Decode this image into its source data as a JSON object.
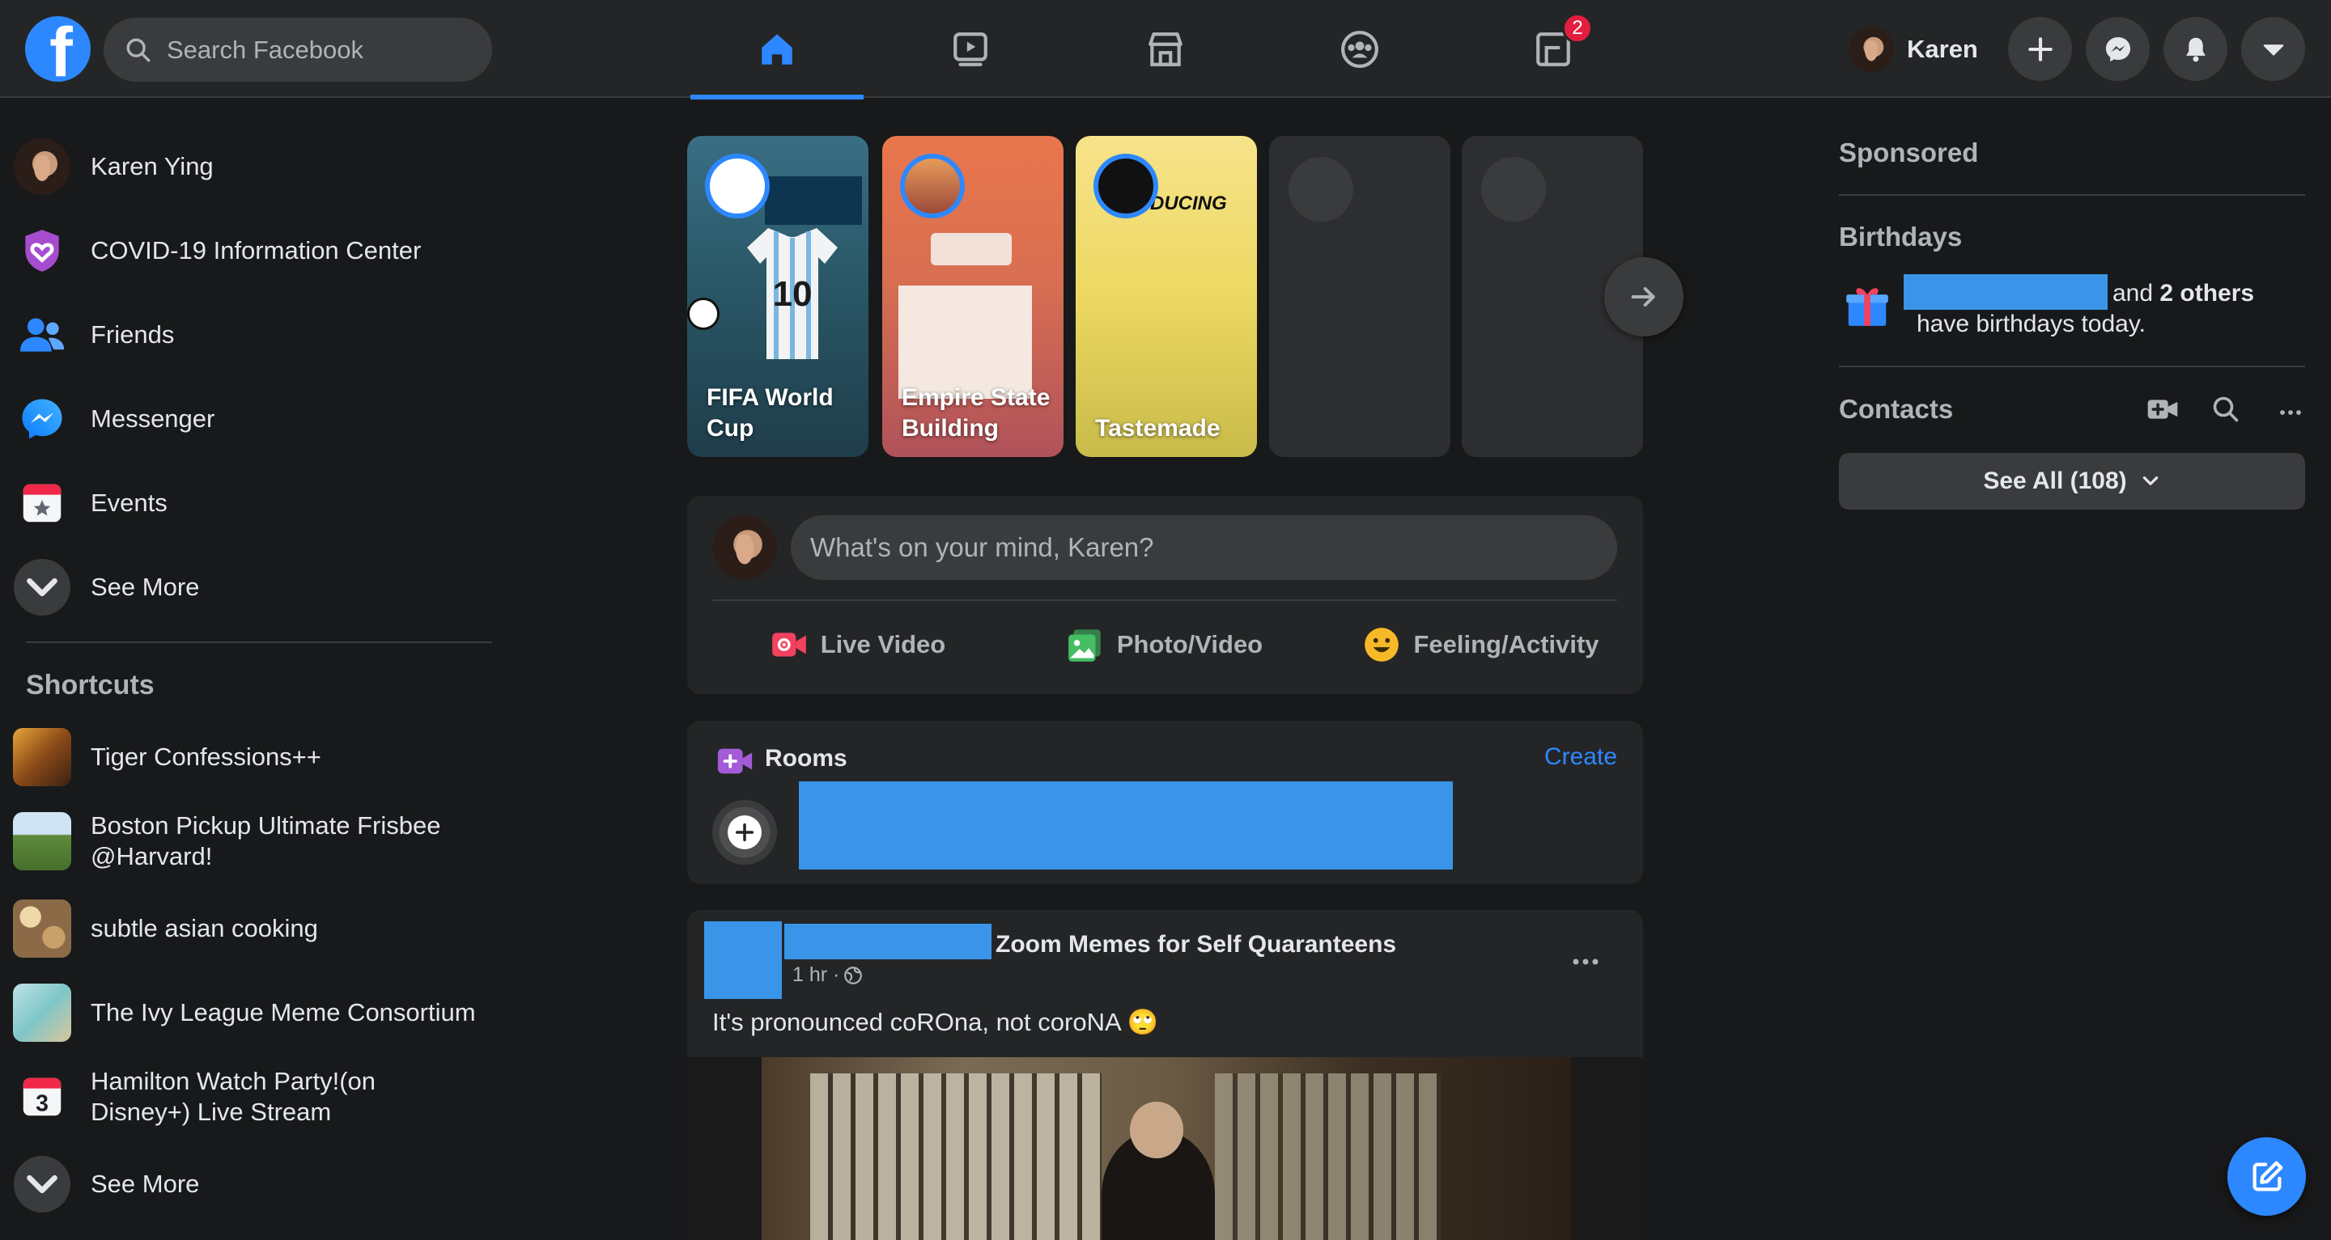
{
  "header": {
    "search_placeholder": "Search Facebook",
    "tabs": [
      {
        "name": "home",
        "active": true
      },
      {
        "name": "watch"
      },
      {
        "name": "marketplace"
      },
      {
        "name": "groups"
      },
      {
        "name": "gaming",
        "badge": "2"
      }
    ],
    "profile_name": "Karen",
    "accent_color": "#2d88ff"
  },
  "left_nav": {
    "items": [
      {
        "label": "Karen Ying",
        "icon": "avatar"
      },
      {
        "label": "COVID-19 Information Center",
        "icon": "covid-heart-icon"
      },
      {
        "label": "Friends",
        "icon": "friends-icon"
      },
      {
        "label": "Messenger",
        "icon": "messenger-icon"
      },
      {
        "label": "Events",
        "icon": "events-icon"
      },
      {
        "label": "See More",
        "icon": "chevron-down-icon"
      }
    ],
    "shortcuts_title": "Shortcuts",
    "shortcuts": [
      {
        "label": "Tiger Confessions++"
      },
      {
        "label": "Boston Pickup Ultimate Frisbee @Harvard!"
      },
      {
        "label": "subtle asian cooking"
      },
      {
        "label": "The Ivy League Meme Consortium"
      },
      {
        "label": "Hamilton Watch Party!(on Disney+) Live Stream"
      },
      {
        "label": "See More"
      }
    ]
  },
  "stories": [
    {
      "name": "FIFA World Cup"
    },
    {
      "name": "Empire State Building"
    },
    {
      "name": "Tastemade"
    },
    {
      "name": ""
    },
    {
      "name": ""
    }
  ],
  "composer": {
    "placeholder": "What's on your mind, Karen?",
    "actions": [
      {
        "label": "Live Video",
        "icon": "live-video-icon"
      },
      {
        "label": "Photo/Video",
        "icon": "photo-icon"
      },
      {
        "label": "Feeling/Activity",
        "icon": "feeling-icon"
      }
    ]
  },
  "rooms": {
    "title": "Rooms",
    "create_label": "Create"
  },
  "post": {
    "group_name": "Zoom Memes for Self Quaranteens",
    "time": "1 hr · ",
    "text": "It's pronounced coROna, not coroNA 🙄"
  },
  "right_rail": {
    "sponsored_title": "Sponsored",
    "birthdays_title": "Birthdays",
    "birthday_line1": "and ",
    "birthday_others": "2 others",
    "birthday_line2": "have birthdays today.",
    "contacts_title": "Contacts",
    "see_all_label": "See All (108)"
  }
}
